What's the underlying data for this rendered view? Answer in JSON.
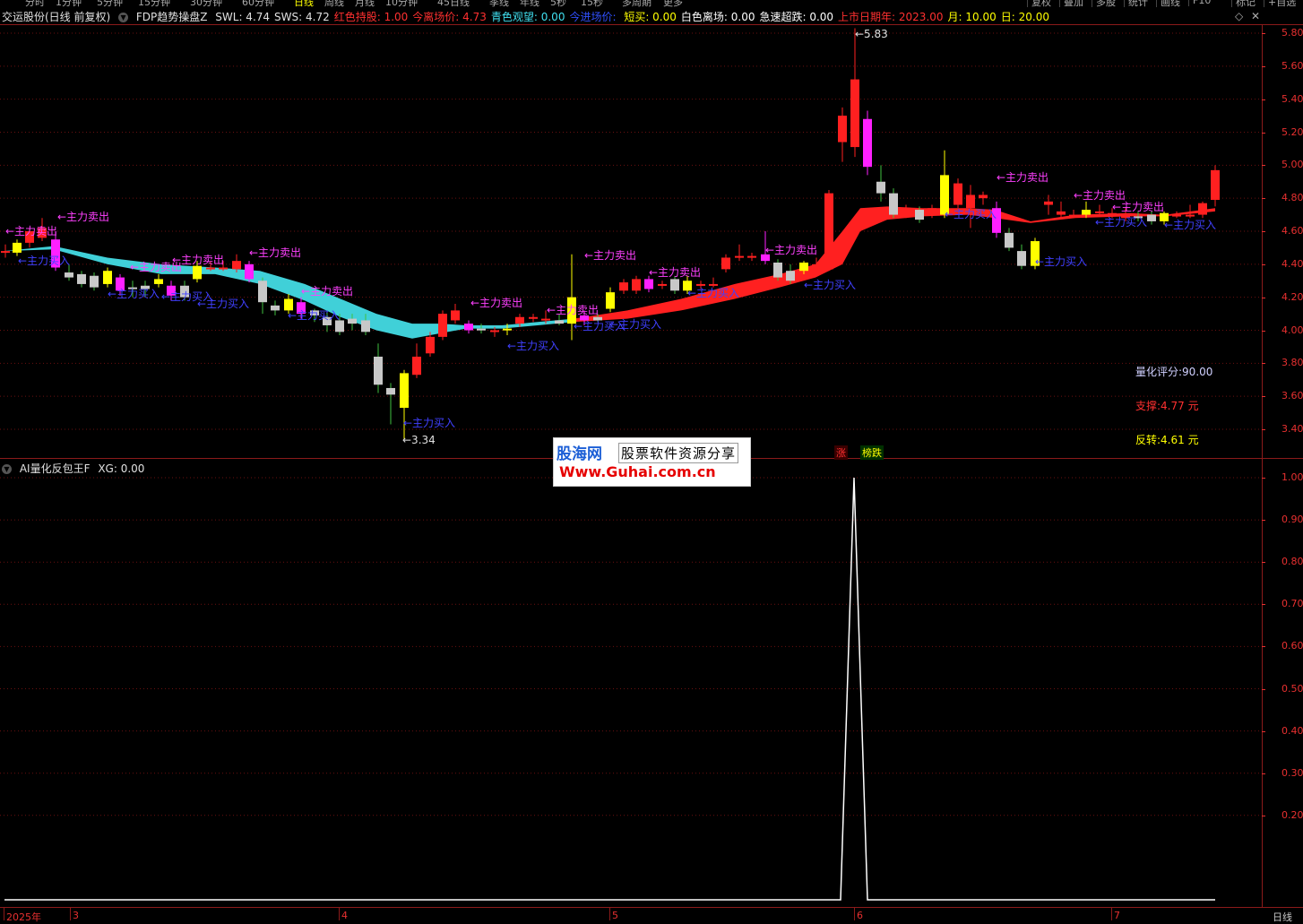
{
  "toolbar": {
    "periods": [
      "分时",
      "1分钟",
      "5分钟",
      "15分钟",
      "30分钟",
      "60分钟",
      "日线",
      "周线",
      "月线",
      "10分钟",
      "45日线",
      "季线",
      "年线",
      "5秒",
      "15秒",
      "多周期",
      "更多"
    ],
    "active_period": "日线",
    "right_buttons": [
      "复权",
      "叠加",
      "多股",
      "统计",
      "画线",
      "F10",
      "标记",
      "+自选",
      "返回"
    ]
  },
  "main_header": {
    "stock": "交运股份(日线 前复权)",
    "indicator": "FDP趋势操盘Z",
    "items": [
      {
        "label": "SWL: 4.74",
        "color": "#e0e0e0"
      },
      {
        "label": "SWS: 4.72",
        "color": "#e0e0e0"
      },
      {
        "label": "红色持股: 1.00",
        "color": "#ff3030"
      },
      {
        "label": "今离场价: 4.73",
        "color": "#ff3030"
      },
      {
        "label": "青色观望: 0.00",
        "color": "#40e0f0"
      },
      {
        "label": "今进场价: ",
        "color": "#3050ff"
      },
      {
        "label": "短买: 0.00",
        "color": "#ffff00"
      },
      {
        "label": "白色离场: 0.00",
        "color": "#ffffff"
      },
      {
        "label": "急速超跌: 0.00",
        "color": "#ffffff"
      },
      {
        "label": "上市日期年: 2023.00",
        "color": "#ff3030"
      },
      {
        "label": "月: 10.00",
        "color": "#ffff00"
      },
      {
        "label": "日: 20.00",
        "color": "#ffff00"
      }
    ]
  },
  "window_controls": {
    "restore": "◇",
    "close": "✕"
  },
  "sub_header": {
    "indicator": "AI量化反包王F",
    "value": "XG: 0.00"
  },
  "price_axis": [
    "5.80",
    "5.60",
    "5.40",
    "5.20",
    "5.00",
    "4.80",
    "4.60",
    "4.40",
    "4.20",
    "4.00",
    "3.80",
    "3.60",
    "3.40"
  ],
  "osc_axis": [
    "1.00",
    "0.90",
    "0.80",
    "0.70",
    "0.60",
    "0.50",
    "0.40",
    "0.30",
    "0.20"
  ],
  "side_panel": {
    "score": {
      "text": "量化评分:90.00",
      "color": "#d0d0ff"
    },
    "support": {
      "text": "支撑:4.77 元",
      "color": "#ff3030"
    },
    "reverse": {
      "text": "反转:4.61 元",
      "color": "#ffff00"
    }
  },
  "annotations": {
    "high": "5.83",
    "low": "3.34",
    "sell_label": "←主力卖出",
    "buy_label": "←主力买入"
  },
  "badges": {
    "up": "涨",
    "rank": "榜跌"
  },
  "watermark": {
    "name": "股海网",
    "slogan": "股票软件资源分享",
    "url": "Www.Guhai.com.cn"
  },
  "x_axis": [
    "2025年",
    "3",
    "4",
    "5",
    "6",
    "7"
  ],
  "bottom_right": "日线",
  "colors": {
    "up": "#ff2020",
    "down": "#c8c8c8",
    "cyan": "#40d0d8",
    "magenta": "#ff20ff",
    "yellow": "#ffff00",
    "sell": "#ff40ff",
    "buy": "#4040ff"
  }
}
